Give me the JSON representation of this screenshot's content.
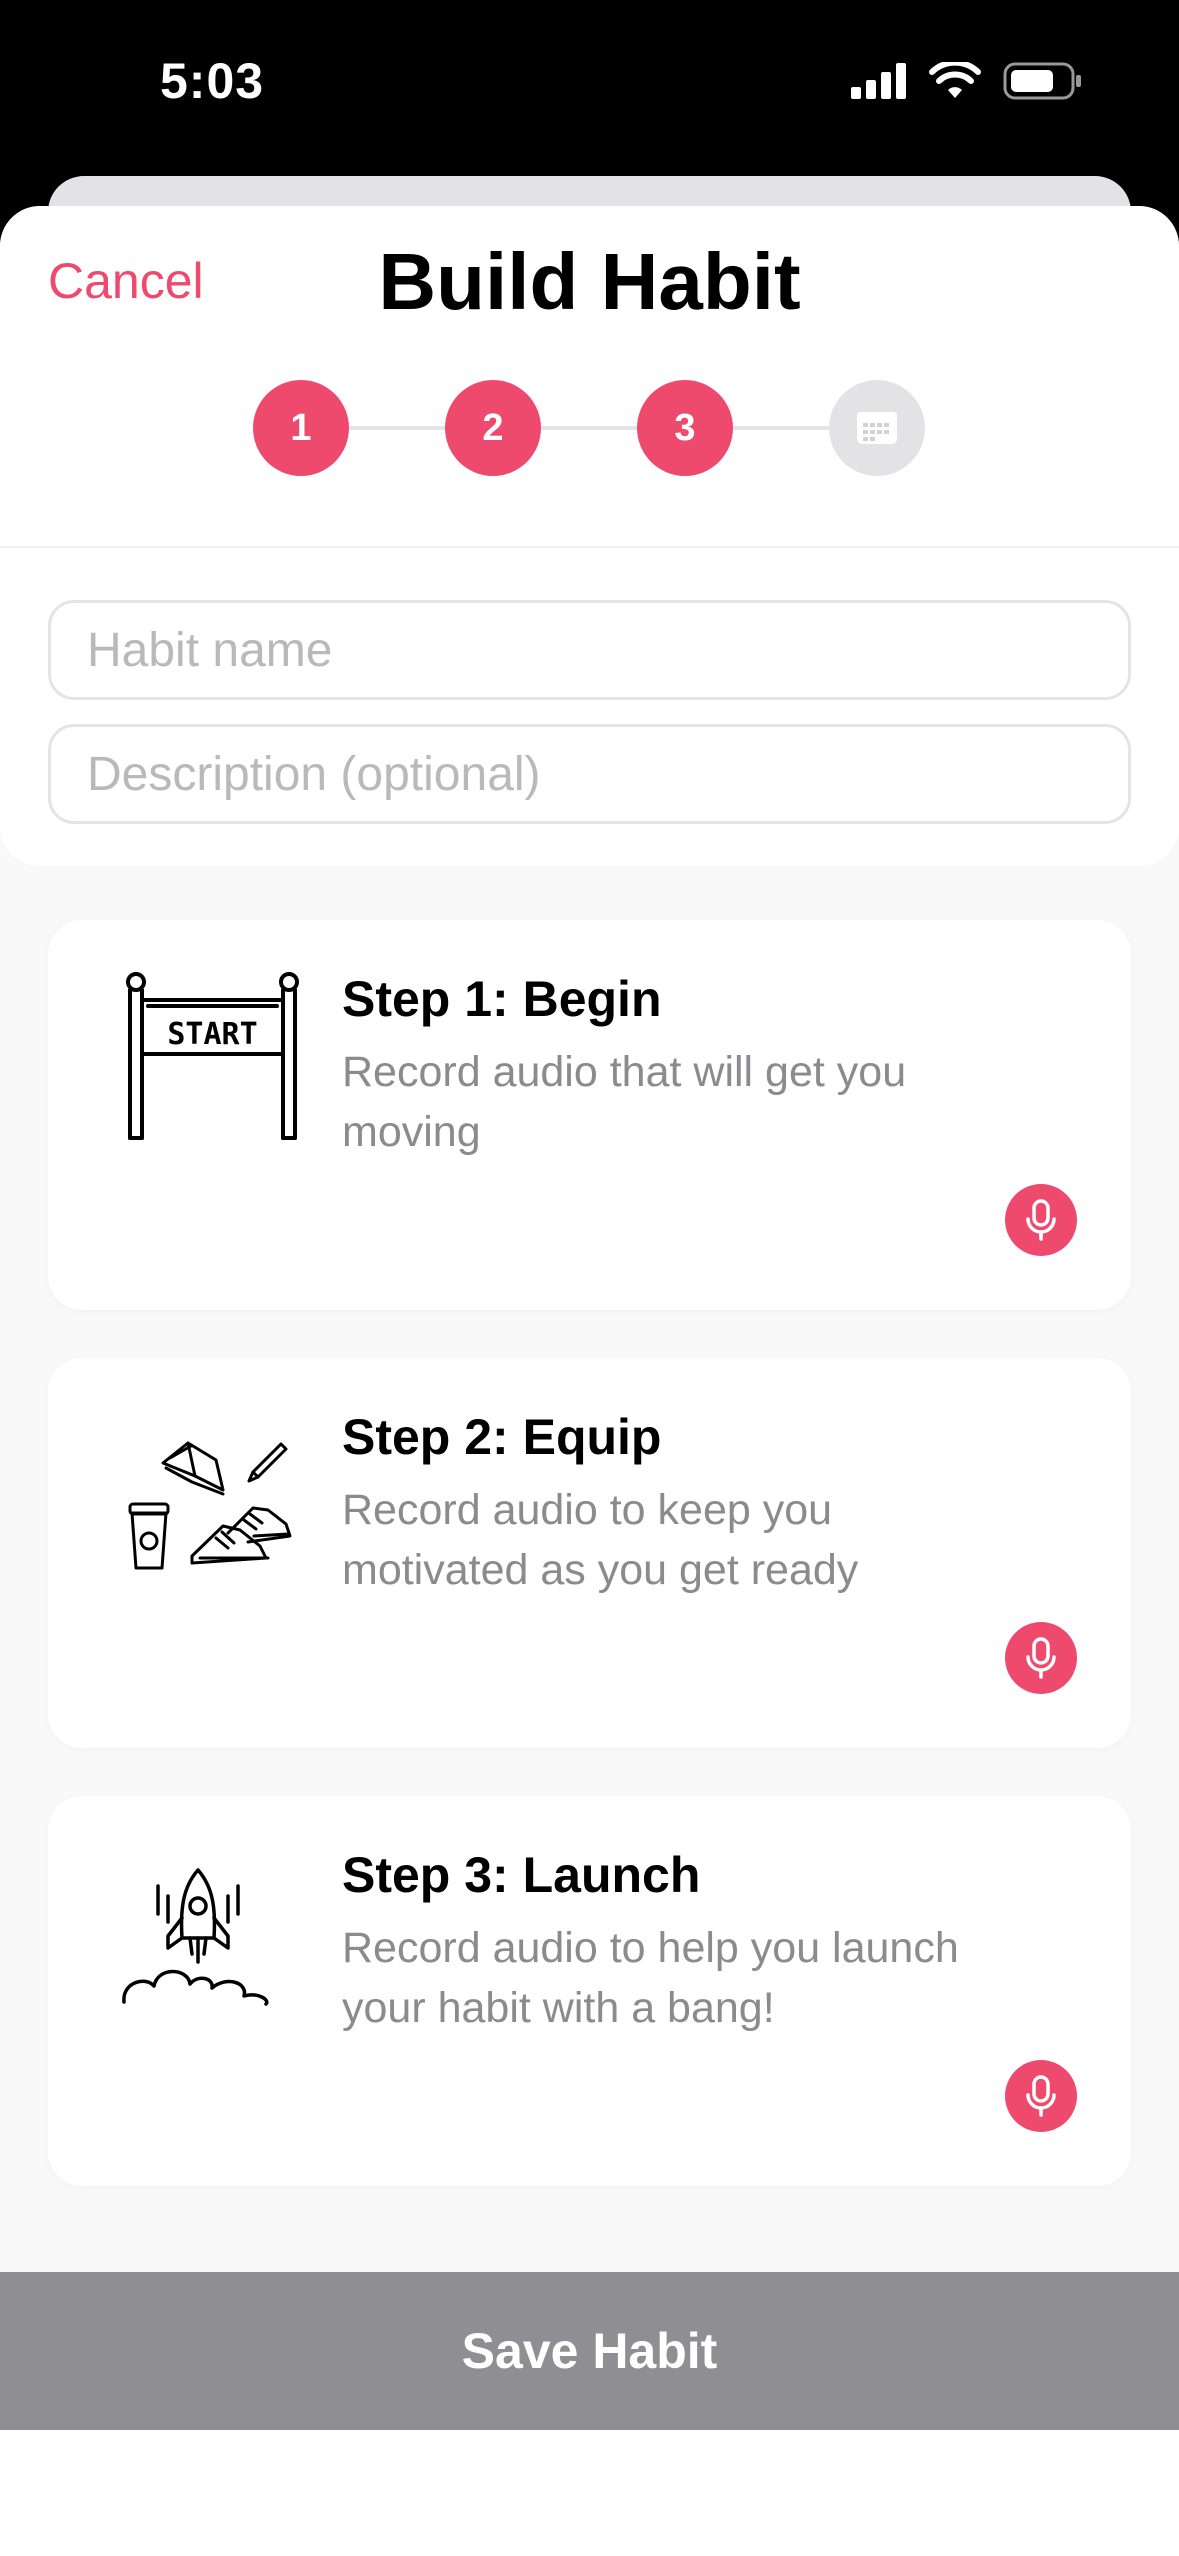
{
  "status_bar": {
    "time": "5:03",
    "icons": [
      "cellular-signal-icon",
      "wifi-icon",
      "battery-icon"
    ]
  },
  "header": {
    "cancel_label": "Cancel",
    "title": "Build Habit"
  },
  "stepper": {
    "steps": [
      {
        "label": "1",
        "active": true
      },
      {
        "label": "2",
        "active": true
      },
      {
        "label": "3",
        "active": true
      },
      {
        "icon": "calendar-icon",
        "active": false
      }
    ],
    "active_color": "#ee4a6e"
  },
  "form": {
    "habit_name": {
      "value": "",
      "placeholder": "Habit name"
    },
    "description": {
      "value": "",
      "placeholder": "Description (optional)"
    }
  },
  "steps": [
    {
      "title": "Step 1: Begin",
      "description": "Record audio that will get you moving",
      "illustration": "start-banner-icon",
      "action_icon": "microphone-icon"
    },
    {
      "title": "Step 2: Equip",
      "description": "Record audio to keep you motivated as you get ready",
      "illustration": "gear-items-icon",
      "action_icon": "microphone-icon"
    },
    {
      "title": "Step 3: Launch",
      "description": "Record audio to help you launch your habit with a bang!",
      "illustration": "rocket-launch-icon",
      "action_icon": "microphone-icon"
    }
  ],
  "footer": {
    "save_label": "Save Habit"
  },
  "illustration_text": {
    "start_sign": "START"
  }
}
